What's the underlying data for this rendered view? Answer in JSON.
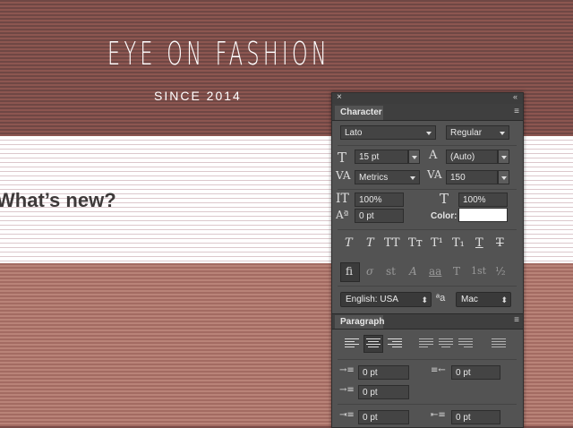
{
  "page": {
    "logo": "EYE ON FASHION",
    "since": "SINCE 2014",
    "headline": "What’s new?"
  },
  "panel": {
    "close_glyph": "×",
    "collapse_glyph": "«",
    "menu_glyph": "≡",
    "character_tab": "Character",
    "paragraph_tab": "Paragraph",
    "font_family": "Lato",
    "font_style": "Regular",
    "font_size": "15 pt",
    "leading": "(Auto)",
    "kerning": "Metrics",
    "tracking": "150",
    "vertical_scale": "100%",
    "horizontal_scale": "100%",
    "baseline_shift": "0 pt",
    "color_label": "Color:",
    "color_value": "#ffffff",
    "language": "English: USA",
    "antialias_glyph": "ªa",
    "antialias": "Mac",
    "type_styles": [
      "T",
      "T",
      "TT",
      "Tт",
      "T¹",
      "T₁",
      "T",
      "T"
    ],
    "opentype_features": [
      "ﬁ",
      "σ",
      "st",
      "A",
      "aa",
      "T",
      "1st",
      "½"
    ],
    "indent_left": "0 pt",
    "indent_right": "0 pt",
    "indent_first": "0 pt",
    "space_before": "0 pt",
    "space_after": "0 pt"
  }
}
